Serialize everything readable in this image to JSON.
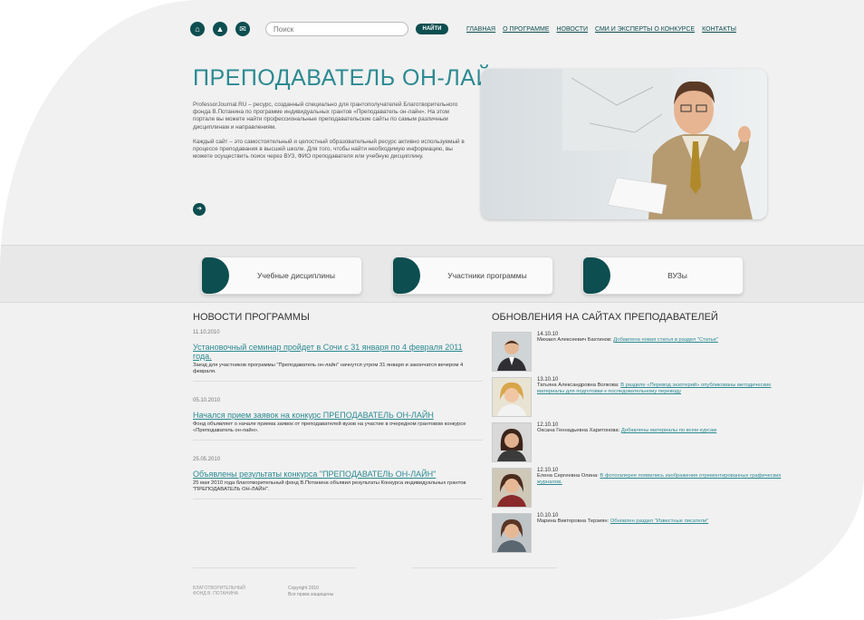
{
  "header": {
    "search_placeholder": "Поиск",
    "search_button": "НАЙТИ",
    "nav": [
      "ГЛАВНАЯ",
      "О ПРОГРАММЕ",
      "НОВОСТИ",
      "СМИ И ЭКСПЕРТЫ О КОНКУРСЕ",
      "КОНТАКТЫ"
    ],
    "icons": [
      "home-icon",
      "sitemap-icon",
      "mail-icon"
    ]
  },
  "hero": {
    "title": "ПРЕПОДАВАТЕЛЬ ОН-ЛАЙН",
    "paragraph1": "ProfessorJournal.RU – ресурс, созданный специально для грантополучателей Благотворительного фонда В.Потанина по программе индивидуальных грантов «Преподаватель он-лайн». На этом портале вы можете найти профессиональные преподавательские сайты по самым различным дисциплинам и направлениям.",
    "paragraph2": "Каждый сайт – это самостоятельный и целостный образовательный ресурс активно используемый в процессе преподавания в высшей школе. Для того, чтобы найти необходимую информацию, вы можете осуществить поиск через ВУЗ, ФИО преподавателя или учебную дисциплину."
  },
  "tabs": [
    "Учебные дисциплины",
    "Участники программы",
    "ВУЗы"
  ],
  "news": {
    "heading": "НОВОСТИ ПРОГРАММЫ",
    "items": [
      {
        "date": "11.10.2010",
        "title": "Установочный семинар пройдет в Сочи с 31 января по 4 февраля 2011 года.",
        "text": "Заезд для участников программы \"Преподаватель он-лайн\" начнутся утром 31 января и закончатся вечером 4 февраля."
      },
      {
        "date": "05.10.2010",
        "title": "Начался прием заявок на конкурс ПРЕПОДАВАТЕЛЬ ОН-ЛАЙН",
        "text": "Фонд объявляет о начале приема заявок от преподавателей вузов на участие в очередном грантовом конкурсе «Преподаватель он-лайн»."
      },
      {
        "date": "25.05.2010",
        "title": "Объявлены результаты конкурса \"ПРЕПОДАВАТЕЛЬ ОН-ЛАЙН\"",
        "text": "25 мая 2010 года благотворительный фонд В.Потанина объявил результаты Конкурса индивидуальных грантов \"ПРЕПОДАВАТЕЛЬ ОН-ЛАЙН\"."
      }
    ]
  },
  "updates": {
    "heading": "ОБНОВЛЕНИЯ НА САЙТАХ ПРЕПОДАВАТЕЛЕЙ",
    "items": [
      {
        "date": "14.10.10",
        "name": "Михаил Алексеевич Бахтинов:",
        "link": "Добавлена новая статья в раздел \"Статьи\""
      },
      {
        "date": "13.10.10",
        "name": "Татьяна Александровна Волкова:",
        "link": "В разделе «Перевод экзотерий» опубликованы методические материалы для подготовки к последовательному переводу"
      },
      {
        "date": "12.10.10",
        "name": "Оксана Геннадьевна Харитонова:",
        "link": "Добавлены материалы по всем курсам"
      },
      {
        "date": "12.10.10",
        "name": "Елена Сергеевна Олина:",
        "link": "В фотогалерее появились изображения отремонтированных графических журналов."
      },
      {
        "date": "10.10.10",
        "name": "Марина Викторовна Терзиян:",
        "link": "Обновлен раздел \"Известные писатели\""
      }
    ]
  },
  "footer": {
    "logo": "БЛАГОТВОРИТЕЛЬНЫЙ ФОНД В. ПОТАНИНА",
    "copyright": "Copyright 2010",
    "rights": "Все права защищены"
  },
  "colors": {
    "accent": "#0d4e50",
    "title": "#2c8a92",
    "background": "#f1f1f1"
  }
}
